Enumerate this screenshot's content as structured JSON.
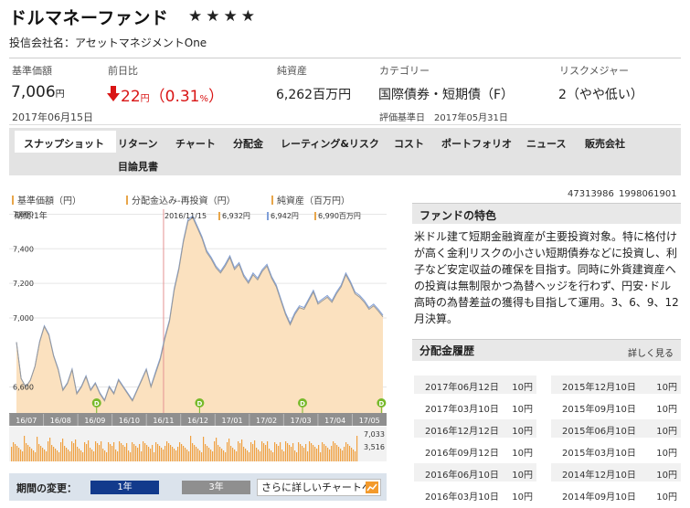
{
  "fund": {
    "name": "ドルマネーファンド",
    "rating": "★★★★",
    "company": "投信会社名：アセットマネジメントOne"
  },
  "stats": {
    "nav_label": "基準価額",
    "nav_value": "7,006",
    "nav_unit": "円",
    "nav_date": "2017年06月15日",
    "change_label": "前日比",
    "change_value": "22",
    "change_unit": "円",
    "change_pct": "（0.31",
    "change_pct_unit": "%",
    "change_pct_close": "）",
    "assets_label": "純資産",
    "assets_value": "6,262百万円",
    "category_label": "カテゴリー",
    "category_value": "国際債券・短期債（F）",
    "rating_date_label": "評価基準日",
    "rating_date": "2017年05月31日",
    "risk_label": "リスクメジャー",
    "risk_value": "2（やや低い）"
  },
  "colors": {
    "down": "#d91515",
    "nav_line": "#888888",
    "reinvest_line": "#7f9fd9",
    "assets_fill": "#fbe1bf",
    "dividend_marker": "#77b92a",
    "btn_active": "#123a8c"
  },
  "nav": {
    "tabs": [
      "スナップショット",
      "リターン",
      "チャート",
      "分配金",
      "レーティング&リスク",
      "コスト",
      "ポートフォリオ",
      "ニュース",
      "販売会社",
      "目論見書"
    ],
    "active": "スナップショット"
  },
  "chart_legend": {
    "nav": "基準価額（円）",
    "reinvest": "分配金込み-再投資（円）",
    "assets": "純資産（百万円）"
  },
  "chart_data": {
    "type": "area",
    "period_label": "期間:1年",
    "hover": {
      "date": "2016/11/15",
      "nav": "6,932円",
      "reinvest": "6,942円",
      "assets": "6,990百万円"
    },
    "y_ticks": [
      "7,600",
      "7,400",
      "7,200",
      "7,000",
      "6,600"
    ],
    "y_tick_values": [
      7600,
      7400,
      7200,
      7000,
      6600
    ],
    "ylim": [
      6450,
      7650
    ],
    "x_labels": [
      "16/07",
      "16/08",
      "16/09",
      "16/10",
      "16/11",
      "16/12",
      "17/01",
      "17/02",
      "17/03",
      "17/04",
      "17/05"
    ],
    "series": [
      {
        "name": "基準価額（円）",
        "values": [
          6860,
          6650,
          6600,
          6640,
          6720,
          6860,
          6950,
          6900,
          6780,
          6700,
          6580,
          6620,
          6700,
          6560,
          6600,
          6660,
          6580,
          6620,
          6560,
          6520,
          6600,
          6560,
          6640,
          6600,
          6560,
          6520,
          6580,
          6640,
          6700,
          6600,
          6680,
          6760,
          6880,
          6980,
          7160,
          7280,
          7440,
          7560,
          7580,
          7520,
          7460,
          7380,
          7340,
          7290,
          7260,
          7300,
          7350,
          7280,
          7310,
          7240,
          7200,
          7250,
          7220,
          7270,
          7300,
          7230,
          7180,
          7100,
          7020,
          6960,
          7020,
          7060,
          7050,
          7100,
          7150,
          7080,
          7100,
          7120,
          7090,
          7140,
          7180,
          7250,
          7200,
          7140,
          7120,
          7090,
          7050,
          7070,
          7040,
          7006
        ]
      },
      {
        "name": "分配金込み-再投資（円）",
        "values": [
          6860,
          6650,
          6600,
          6640,
          6720,
          6865,
          6955,
          6905,
          6785,
          6705,
          6585,
          6625,
          6705,
          6565,
          6605,
          6665,
          6585,
          6625,
          6565,
          6525,
          6605,
          6565,
          6645,
          6605,
          6565,
          6525,
          6585,
          6645,
          6705,
          6605,
          6690,
          6770,
          6890,
          6990,
          7170,
          7290,
          7450,
          7570,
          7590,
          7530,
          7470,
          7390,
          7350,
          7300,
          7270,
          7310,
          7360,
          7290,
          7320,
          7250,
          7210,
          7260,
          7230,
          7280,
          7310,
          7240,
          7190,
          7110,
          7030,
          6970,
          7030,
          7070,
          7060,
          7110,
          7160,
          7090,
          7110,
          7130,
          7100,
          7150,
          7190,
          7260,
          7210,
          7150,
          7130,
          7100,
          7060,
          7080,
          7050,
          7016
        ]
      }
    ],
    "dividend_markers": [
      "16/09",
      "16/12",
      "17/03",
      "17/06"
    ],
    "volume_labels": [
      "7,033",
      "3,516"
    ]
  },
  "period": {
    "label": "期間の変更：",
    "one_year": "1年",
    "three_year": "3年",
    "more": "さらに詳しいチャートへ"
  },
  "codes": {
    "code1": "47313986",
    "code2": "1998061901"
  },
  "features": {
    "title": "ファンドの特色",
    "text": "米ドル建て短期金融資産が主要投資対象。特に格付けが高く金利リスクの小さい短期債券などに投資し、利子など安定収益の確保を目指す。同時に外貨建資産への投資は無制限かつ為替ヘッジを行わず、円安･ドル高時の為替差益の獲得も目指して運用。3、6、9、12月決算。"
  },
  "dividends": {
    "title": "分配金履歴",
    "more": "詳しく見る",
    "left": [
      {
        "date": "2017年06月12日",
        "amount": "10円"
      },
      {
        "date": "2017年03月10日",
        "amount": "10円"
      },
      {
        "date": "2016年12月12日",
        "amount": "10円"
      },
      {
        "date": "2016年09月12日",
        "amount": "10円"
      },
      {
        "date": "2016年06月10日",
        "amount": "10円"
      },
      {
        "date": "2016年03月10日",
        "amount": "10円"
      }
    ],
    "right": [
      {
        "date": "2015年12月10日",
        "amount": "10円"
      },
      {
        "date": "2015年09月10日",
        "amount": "10円"
      },
      {
        "date": "2015年06月10日",
        "amount": "10円"
      },
      {
        "date": "2015年03月10日",
        "amount": "10円"
      },
      {
        "date": "2014年12月10日",
        "amount": "10円"
      },
      {
        "date": "2014年09月10日",
        "amount": "10円"
      }
    ]
  }
}
